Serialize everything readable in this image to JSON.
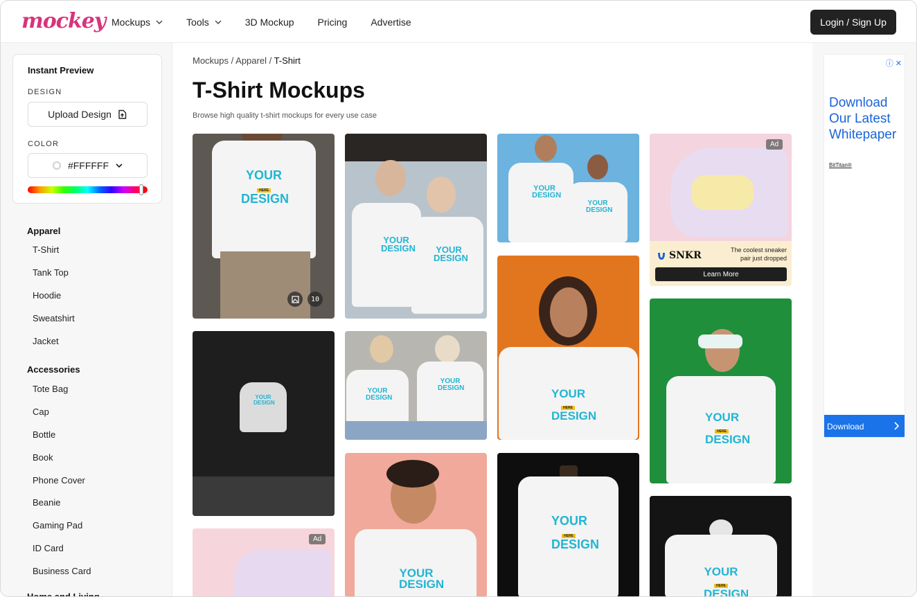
{
  "brand": {
    "logo_text": "mockey",
    "logo_color": "#d6357c"
  },
  "nav": {
    "items": [
      {
        "label": "Mockups",
        "has_dropdown": true
      },
      {
        "label": "Tools",
        "has_dropdown": true
      },
      {
        "label": "3D Mockup",
        "has_dropdown": false
      },
      {
        "label": "Pricing",
        "has_dropdown": false
      },
      {
        "label": "Advertise",
        "has_dropdown": false
      }
    ],
    "login_label": "Login / Sign Up"
  },
  "preview": {
    "title": "Instant Preview",
    "design_label": "DESIGN",
    "upload_label": "Upload Design",
    "color_label": "COLOR",
    "color_value": "#FFFFFF",
    "hue_fraction": 0.95
  },
  "sidebar": {
    "apparel_heading": "Apparel",
    "apparel_items": [
      "T-Shirt",
      "Tank Top",
      "Hoodie",
      "Sweatshirt",
      "Jacket"
    ],
    "accessories_heading": "Accessories",
    "accessories_items": [
      "Tote Bag",
      "Cap",
      "Bottle",
      "Book",
      "Phone Cover",
      "Beanie",
      "Gaming Pad",
      "ID Card",
      "Business Card"
    ],
    "next_heading": "Home and Living"
  },
  "main": {
    "breadcrumb": {
      "part1": "Mockups",
      "sep": " / ",
      "part2": "Apparel",
      "current": "T-Shirt"
    },
    "title": "T-Shirt Mockups",
    "subtitle": "Browse high quality t-shirt mockups for every use case",
    "print": {
      "line1": "YOUR",
      "line2": "HERE",
      "line3": "DESIGN"
    },
    "first_tile_count": "10",
    "ad_badge": "Ad",
    "sneaker_ad": {
      "brand": "SNKR",
      "tagline": "The coolest sneaker pair just dropped",
      "cta": "Learn More"
    }
  },
  "rail_ad": {
    "title": "Download Our Latest Whitepaper",
    "brand": "BitTitan®",
    "cta": "Download"
  },
  "colors": {
    "print_cyan": "#21b5d3",
    "print_yellow": "#f2c018",
    "login_bg": "#222222",
    "ad_blue": "#1a73e8"
  }
}
